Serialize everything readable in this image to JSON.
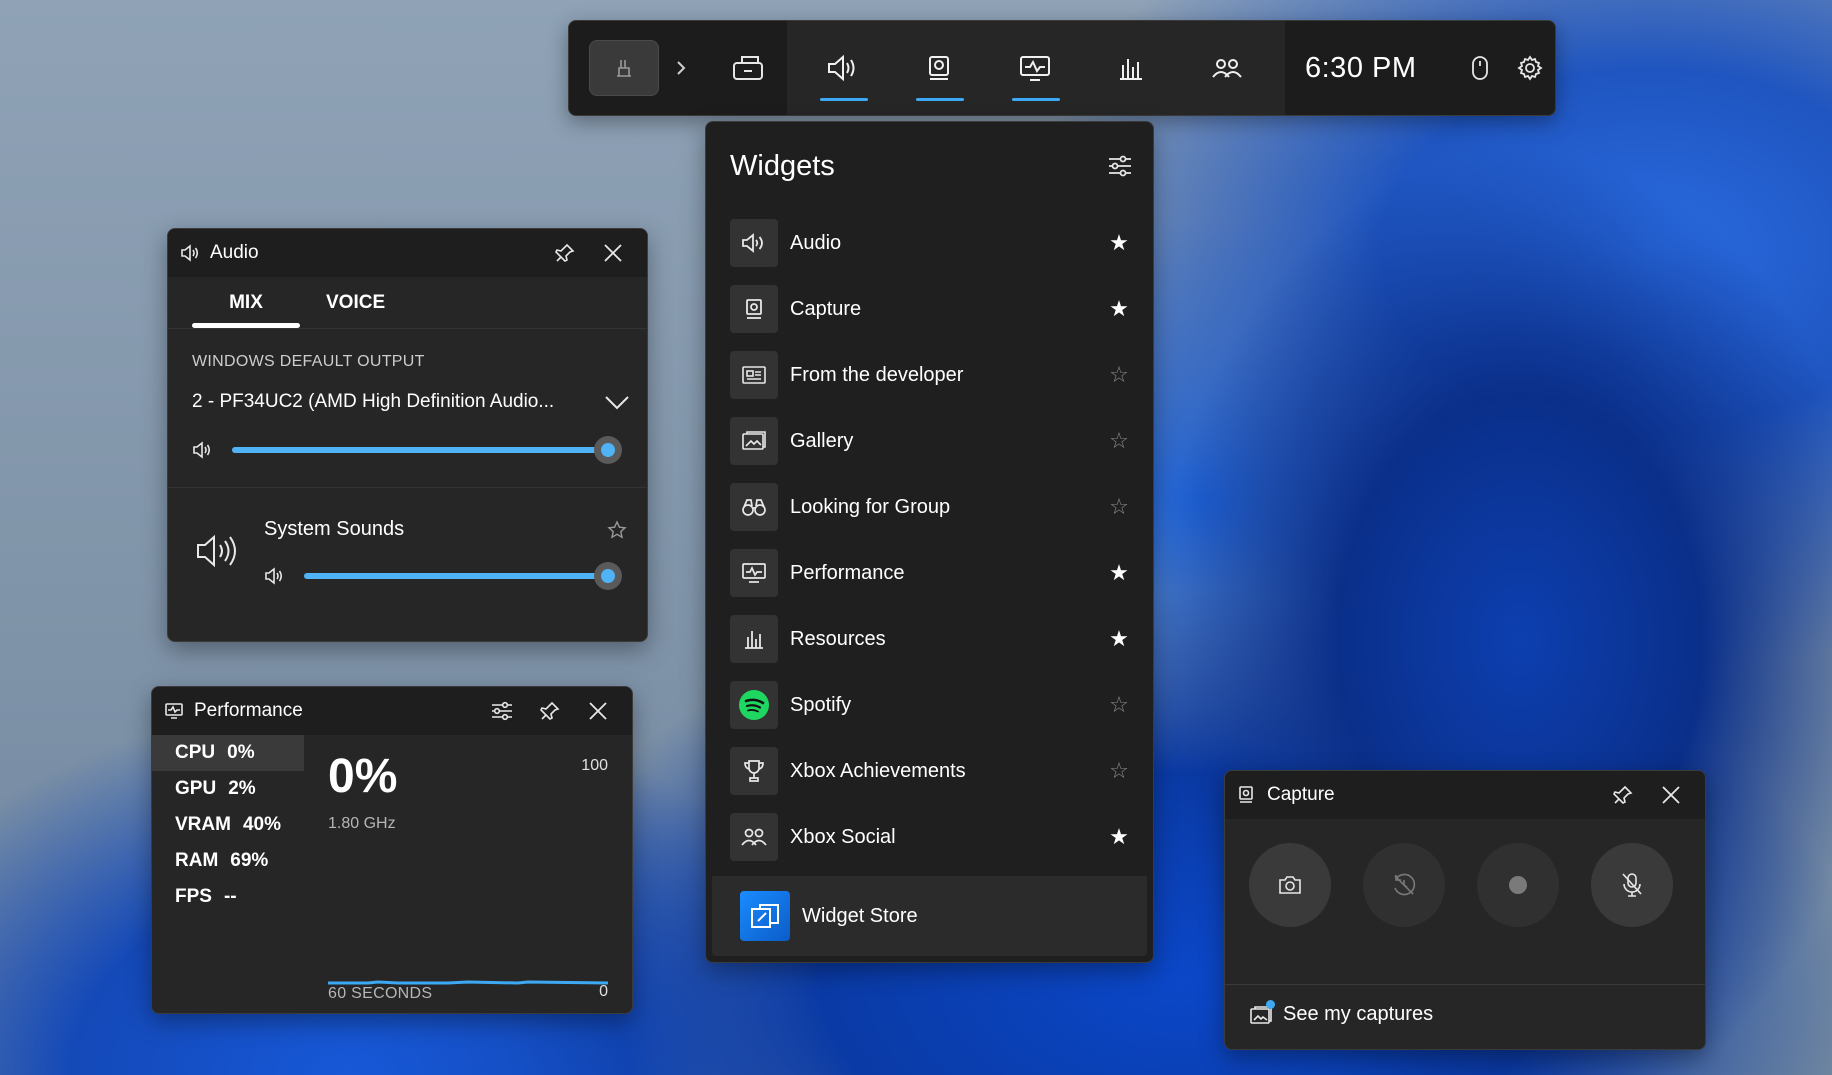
{
  "gamebar": {
    "time": "6:30 PM",
    "buttons": [
      "widget-menu",
      "audio",
      "capture",
      "performance",
      "resources",
      "xbox-social"
    ],
    "accent": "#3da9f4"
  },
  "audio": {
    "title": "Audio",
    "tabs": {
      "mix": "MIX",
      "voice": "VOICE"
    },
    "output_label": "WINDOWS DEFAULT OUTPUT",
    "device": "2 - PF34UC2 (AMD High Definition Audio...",
    "master_volume": 1.0,
    "app": {
      "name": "System Sounds",
      "volume": 1.0,
      "favorite": false
    }
  },
  "widgets": {
    "title": "Widgets",
    "items": [
      {
        "label": "Audio",
        "icon": "speaker-icon",
        "favorite": true
      },
      {
        "label": "Capture",
        "icon": "capture-icon",
        "favorite": true
      },
      {
        "label": "From the developer",
        "icon": "news-icon",
        "favorite": false
      },
      {
        "label": "Gallery",
        "icon": "gallery-icon",
        "favorite": false
      },
      {
        "label": "Looking for Group",
        "icon": "binoculars-icon",
        "favorite": false
      },
      {
        "label": "Performance",
        "icon": "monitor-icon",
        "favorite": true
      },
      {
        "label": "Resources",
        "icon": "bar-chart-icon",
        "favorite": true
      },
      {
        "label": "Spotify",
        "icon": "spotify-icon",
        "favorite": false
      },
      {
        "label": "Xbox Achievements",
        "icon": "trophy-icon",
        "favorite": false
      },
      {
        "label": "Xbox Social",
        "icon": "people-icon",
        "favorite": true
      }
    ],
    "store": "Widget Store"
  },
  "performance": {
    "title": "Performance",
    "stats": [
      {
        "key": "CPU",
        "value": "0%"
      },
      {
        "key": "GPU",
        "value": "2%"
      },
      {
        "key": "VRAM",
        "value": "40%"
      },
      {
        "key": "RAM",
        "value": "69%"
      },
      {
        "key": "FPS",
        "value": "--"
      }
    ],
    "selected": "CPU",
    "big_value": "0%",
    "clock": "1.80 GHz",
    "max": "100",
    "min": "0",
    "window": "60 SECONDS"
  },
  "capture": {
    "title": "Capture",
    "see_captures": "See my captures"
  }
}
